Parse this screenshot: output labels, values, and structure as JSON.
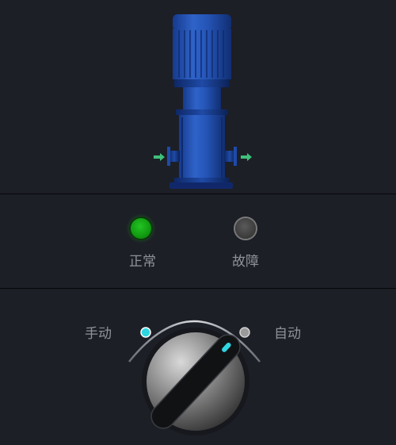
{
  "pump": {
    "icon": "vertical-multistage-pump-icon",
    "flow_in_icon": "arrow-right-icon",
    "flow_out_icon": "arrow-right-icon"
  },
  "status": {
    "normal_label": "正常",
    "fault_label": "故障",
    "normal_on": true,
    "fault_on": false,
    "normal_color": "#14b014",
    "fault_color": "#3f3f3f"
  },
  "mode": {
    "manual_label": "手动",
    "auto_label": "自动",
    "selected": "手动",
    "active_dot_color": "#2fd6e0"
  }
}
